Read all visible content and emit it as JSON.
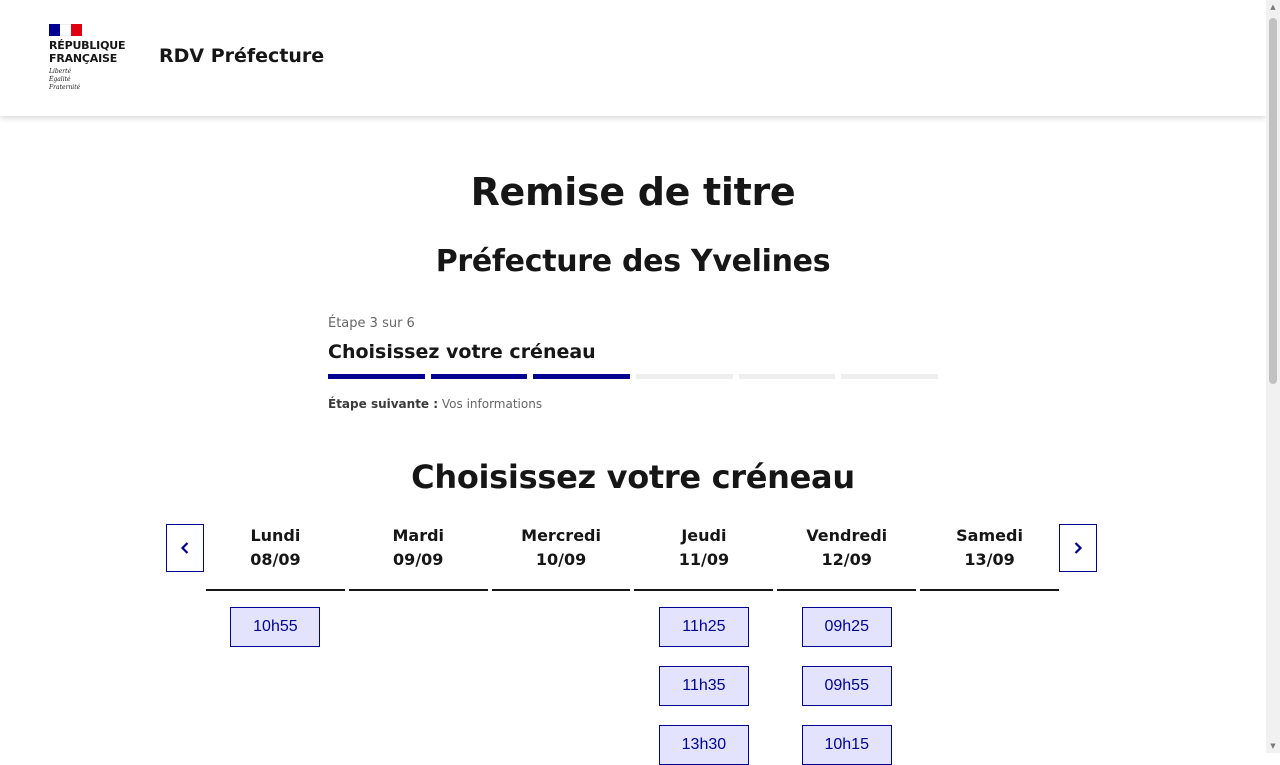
{
  "header": {
    "republique": "RÉPUBLIQUE\nFRANÇAISE",
    "motto": "Liberté\nÉgalité\nFraternité",
    "service_title": "RDV Préfecture"
  },
  "page": {
    "title": "Remise de titre",
    "subtitle": "Préfecture des Yvelines"
  },
  "stepper": {
    "state": "Étape 3 sur 6",
    "title": "Choisissez votre créneau",
    "current_step": 3,
    "total_steps": 6,
    "next_label": "Étape suivante :",
    "next_value": " Vos informations"
  },
  "calendar": {
    "title": "Choisissez votre créneau",
    "days": [
      {
        "name": "Lundi",
        "date": "08/09",
        "slots": [
          "10h55"
        ]
      },
      {
        "name": "Mardi",
        "date": "09/09",
        "slots": []
      },
      {
        "name": "Mercredi",
        "date": "10/09",
        "slots": []
      },
      {
        "name": "Jeudi",
        "date": "11/09",
        "slots": [
          "11h25",
          "11h35",
          "13h30"
        ]
      },
      {
        "name": "Vendredi",
        "date": "12/09",
        "slots": [
          "09h25",
          "09h55",
          "10h15"
        ]
      },
      {
        "name": "Samedi",
        "date": "13/09",
        "slots": []
      }
    ]
  },
  "colors": {
    "primary": "#000091",
    "slot_bg": "#e3e3fd",
    "flag_red": "#e1000f"
  }
}
